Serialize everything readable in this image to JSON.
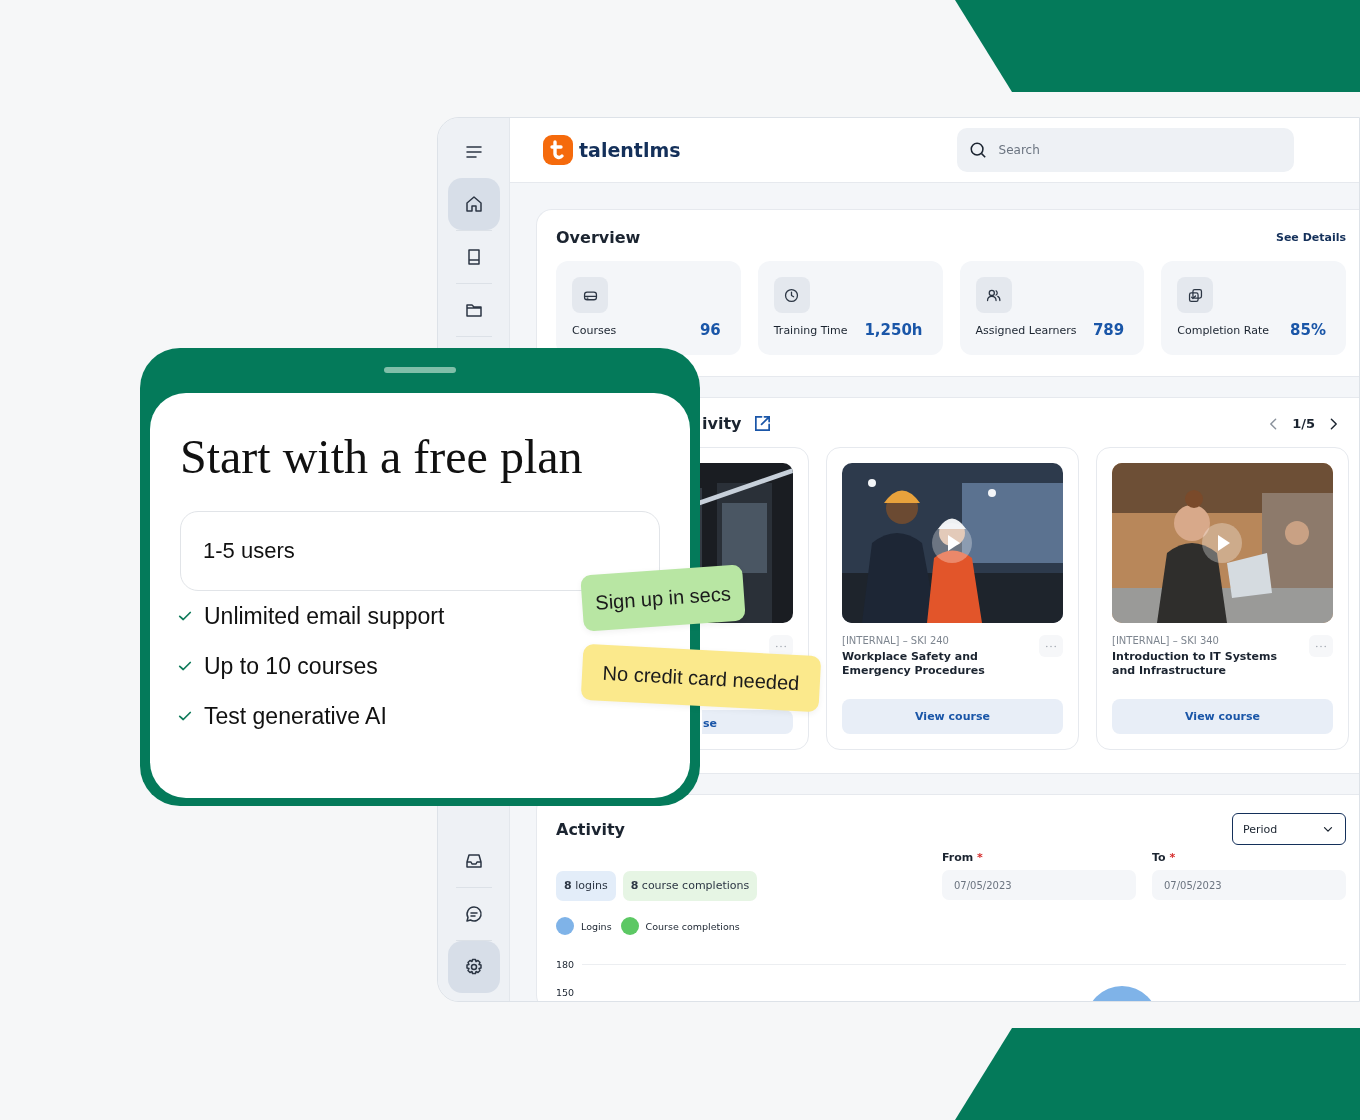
{
  "sidebar": {
    "items": [
      {
        "kind": "menu",
        "selected": false
      },
      {
        "kind": "home",
        "selected": true
      },
      {
        "kind": "book",
        "selected": false
      },
      {
        "kind": "folder",
        "selected": false
      },
      {
        "kind": "inbox",
        "selected": false
      },
      {
        "kind": "chat",
        "selected": false
      },
      {
        "kind": "settings",
        "selected": true
      }
    ]
  },
  "header": {
    "logo": "talentlms",
    "search": {
      "placeholder": "Search"
    }
  },
  "overview": {
    "title": "Overview",
    "link": "See Details",
    "stats": [
      {
        "kind": "courses",
        "label": "Courses",
        "value": "96"
      },
      {
        "kind": "time",
        "label": "Training Time",
        "value": "1,250h"
      },
      {
        "kind": "learners",
        "label": "Assigned Learners",
        "value": "789"
      },
      {
        "kind": "completion",
        "label": "Completion Rate",
        "value": "85%"
      }
    ]
  },
  "courses": {
    "title": "ivity",
    "pager": "1/5",
    "cards": [
      {
        "kind": "picture",
        "button": "se"
      },
      {
        "kind": "picture",
        "meta": "[INTERNAL] – SKI 240",
        "title": "Workplace Safety and Emergency Procedures",
        "button": "View course"
      },
      {
        "kind": "picture",
        "meta": "[INTERNAL] – SKI 340",
        "title": "Introduction to IT Systems and Infrastructure",
        "button": "View course"
      }
    ]
  },
  "activity": {
    "title": "Activity",
    "period": {
      "value": "Period"
    },
    "badges": [
      {
        "text": "**8** logins",
        "color": "#e3edf9"
      },
      {
        "text": "**8** course completions",
        "color": "#e6f5e4"
      }
    ],
    "fields": [
      {
        "label": "From",
        "required": "*",
        "value": "07/05/2023"
      },
      {
        "label": "To",
        "required": "*",
        "value": "07/05/2023"
      }
    ],
    "legend": [
      {
        "label": "Logins",
        "color": "#7fb3e8"
      },
      {
        "label": "Course completions",
        "color": "#5cc864"
      }
    ],
    "y_ticks": [
      "180",
      "150"
    ]
  },
  "promo": {
    "title": "Start with a free plan",
    "plan": "1-5 users",
    "features": [
      "Unlimited email support",
      "Up to 10 courses",
      "Test generative AI"
    ],
    "notes": [
      {
        "text": "Sign up in secs",
        "color": "#b8e6a3"
      },
      {
        "text": "No credit card needed",
        "color": "#fbe98c"
      }
    ]
  }
}
